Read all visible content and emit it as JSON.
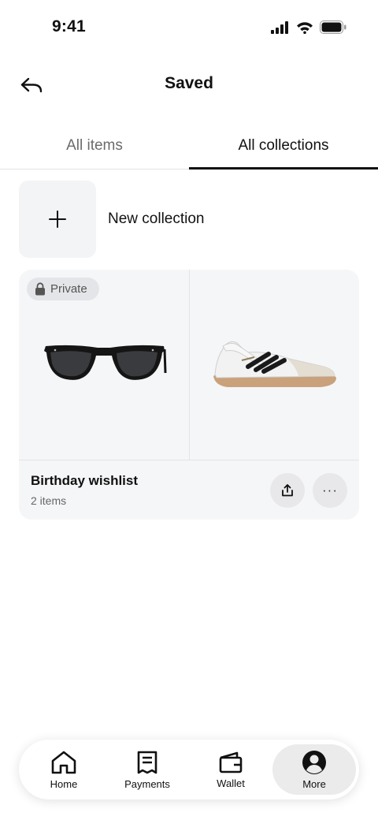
{
  "status_bar": {
    "time": "9:41"
  },
  "header": {
    "title": "Saved"
  },
  "tabs": [
    {
      "label": "All items",
      "active": false
    },
    {
      "label": "All collections",
      "active": true
    }
  ],
  "new_collection": {
    "label": "New collection"
  },
  "collection": {
    "badge": "Private",
    "title": "Birthday wishlist",
    "count": "2 items",
    "images": [
      "sunglasses",
      "sneaker"
    ],
    "more_label": "···"
  },
  "bottom_nav": [
    {
      "label": "Home",
      "icon": "home-icon",
      "active": false
    },
    {
      "label": "Payments",
      "icon": "receipt-icon",
      "active": false
    },
    {
      "label": "Wallet",
      "icon": "wallet-icon",
      "active": false
    },
    {
      "label": "More",
      "icon": "account-icon",
      "active": true
    }
  ],
  "colors": {
    "accent": "#111111",
    "card_bg": "#f5f6f8",
    "active_nav_bg": "#ebebeb"
  }
}
